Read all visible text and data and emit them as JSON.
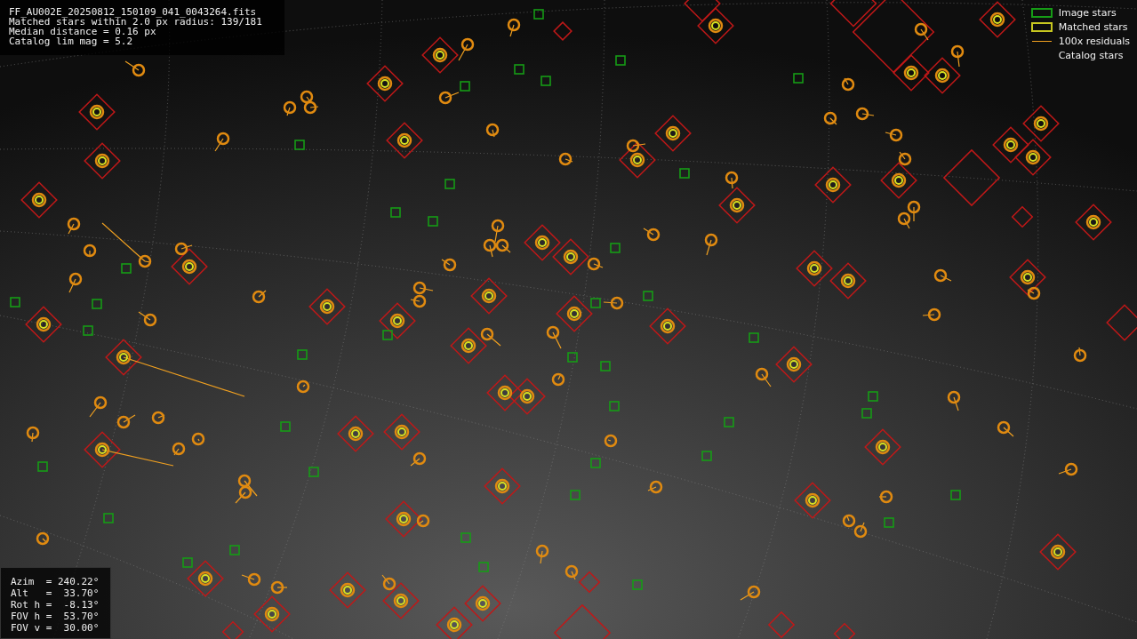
{
  "info_box": {
    "lines": [
      "FF_AU002E_20250812_150109_041_0043264.fits",
      "Matched stars within 2.0 px radius: 139/181",
      "Median distance = 0.16 px",
      "Catalog lim mag = 5.2"
    ]
  },
  "legend": {
    "items": [
      {
        "kind": "image",
        "label": "Image stars"
      },
      {
        "kind": "matched",
        "label": "Matched stars"
      },
      {
        "kind": "residual",
        "label": "100x residuals"
      },
      {
        "kind": "catalog",
        "label": "Catalog stars"
      }
    ]
  },
  "pointing_box": {
    "lines": [
      "Azim  = 240.22°",
      "Alt   =  33.70°",
      "Rot h =  -8.13°",
      "FOV h =  53.70°",
      "FOV v =  30.00°"
    ]
  }
}
